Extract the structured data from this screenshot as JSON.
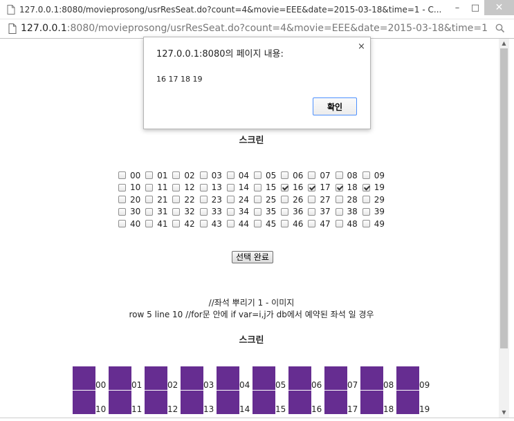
{
  "window": {
    "title": "127.0.0.1:8080/movieprosong/usrResSeat.do?count=4&movie=EEE&date=2015-03-18&time=1 - C...",
    "minimize": "–",
    "maximize": "□",
    "close": "✕"
  },
  "address": {
    "host": "127.0.0.1",
    "path": ":8080/movieprosong/usrResSeat.do?count=4&movie=EEE&date=2015-03-18&time=1"
  },
  "page": {
    "screen_label_1": "스크린",
    "seat_rows": [
      [
        {
          "n": "00",
          "c": false
        },
        {
          "n": "01",
          "c": false
        },
        {
          "n": "02",
          "c": false
        },
        {
          "n": "03",
          "c": false
        },
        {
          "n": "04",
          "c": false
        },
        {
          "n": "05",
          "c": false
        },
        {
          "n": "06",
          "c": false
        },
        {
          "n": "07",
          "c": false
        },
        {
          "n": "08",
          "c": false
        },
        {
          "n": "09",
          "c": false
        }
      ],
      [
        {
          "n": "10",
          "c": false
        },
        {
          "n": "11",
          "c": false
        },
        {
          "n": "12",
          "c": false
        },
        {
          "n": "13",
          "c": false
        },
        {
          "n": "14",
          "c": false
        },
        {
          "n": "15",
          "c": false
        },
        {
          "n": "16",
          "c": true
        },
        {
          "n": "17",
          "c": true
        },
        {
          "n": "18",
          "c": true
        },
        {
          "n": "19",
          "c": true
        }
      ],
      [
        {
          "n": "20",
          "c": false
        },
        {
          "n": "21",
          "c": false
        },
        {
          "n": "22",
          "c": false
        },
        {
          "n": "23",
          "c": false
        },
        {
          "n": "24",
          "c": false
        },
        {
          "n": "25",
          "c": false
        },
        {
          "n": "26",
          "c": false
        },
        {
          "n": "27",
          "c": false
        },
        {
          "n": "28",
          "c": false
        },
        {
          "n": "29",
          "c": false
        }
      ],
      [
        {
          "n": "30",
          "c": false
        },
        {
          "n": "31",
          "c": false
        },
        {
          "n": "32",
          "c": false
        },
        {
          "n": "33",
          "c": false
        },
        {
          "n": "34",
          "c": false
        },
        {
          "n": "35",
          "c": false
        },
        {
          "n": "36",
          "c": false
        },
        {
          "n": "37",
          "c": false
        },
        {
          "n": "38",
          "c": false
        },
        {
          "n": "39",
          "c": false
        }
      ],
      [
        {
          "n": "40",
          "c": false
        },
        {
          "n": "41",
          "c": false
        },
        {
          "n": "42",
          "c": false
        },
        {
          "n": "43",
          "c": false
        },
        {
          "n": "44",
          "c": false
        },
        {
          "n": "45",
          "c": false
        },
        {
          "n": "46",
          "c": false
        },
        {
          "n": "47",
          "c": false
        },
        {
          "n": "48",
          "c": false
        },
        {
          "n": "49",
          "c": false
        }
      ]
    ],
    "select_button": "선택 완료",
    "note_line_1": "//좌석 뿌리기 1 - 이미지",
    "note_line_2": "row 5 line 10 //for문 안에 if var=i,j가 db에서 예약된 좌석 일 경우",
    "screen_label_2": "스크린",
    "image_rows": [
      [
        "00",
        "01",
        "02",
        "03",
        "04",
        "05",
        "06",
        "07",
        "08",
        "09"
      ],
      [
        "10",
        "11",
        "12",
        "13",
        "14",
        "15",
        "16",
        "17",
        "18",
        "19"
      ]
    ],
    "seat_block_color": "#662d91"
  },
  "dialog": {
    "title": "127.0.0.1:8080의 페이지 내용:",
    "close": "×",
    "message": "16  17  18  19",
    "ok_label": "확인"
  },
  "icons": {
    "doc": "document-icon",
    "search": "search-icon",
    "scroll_up": "▲",
    "scroll_down": "▼"
  }
}
